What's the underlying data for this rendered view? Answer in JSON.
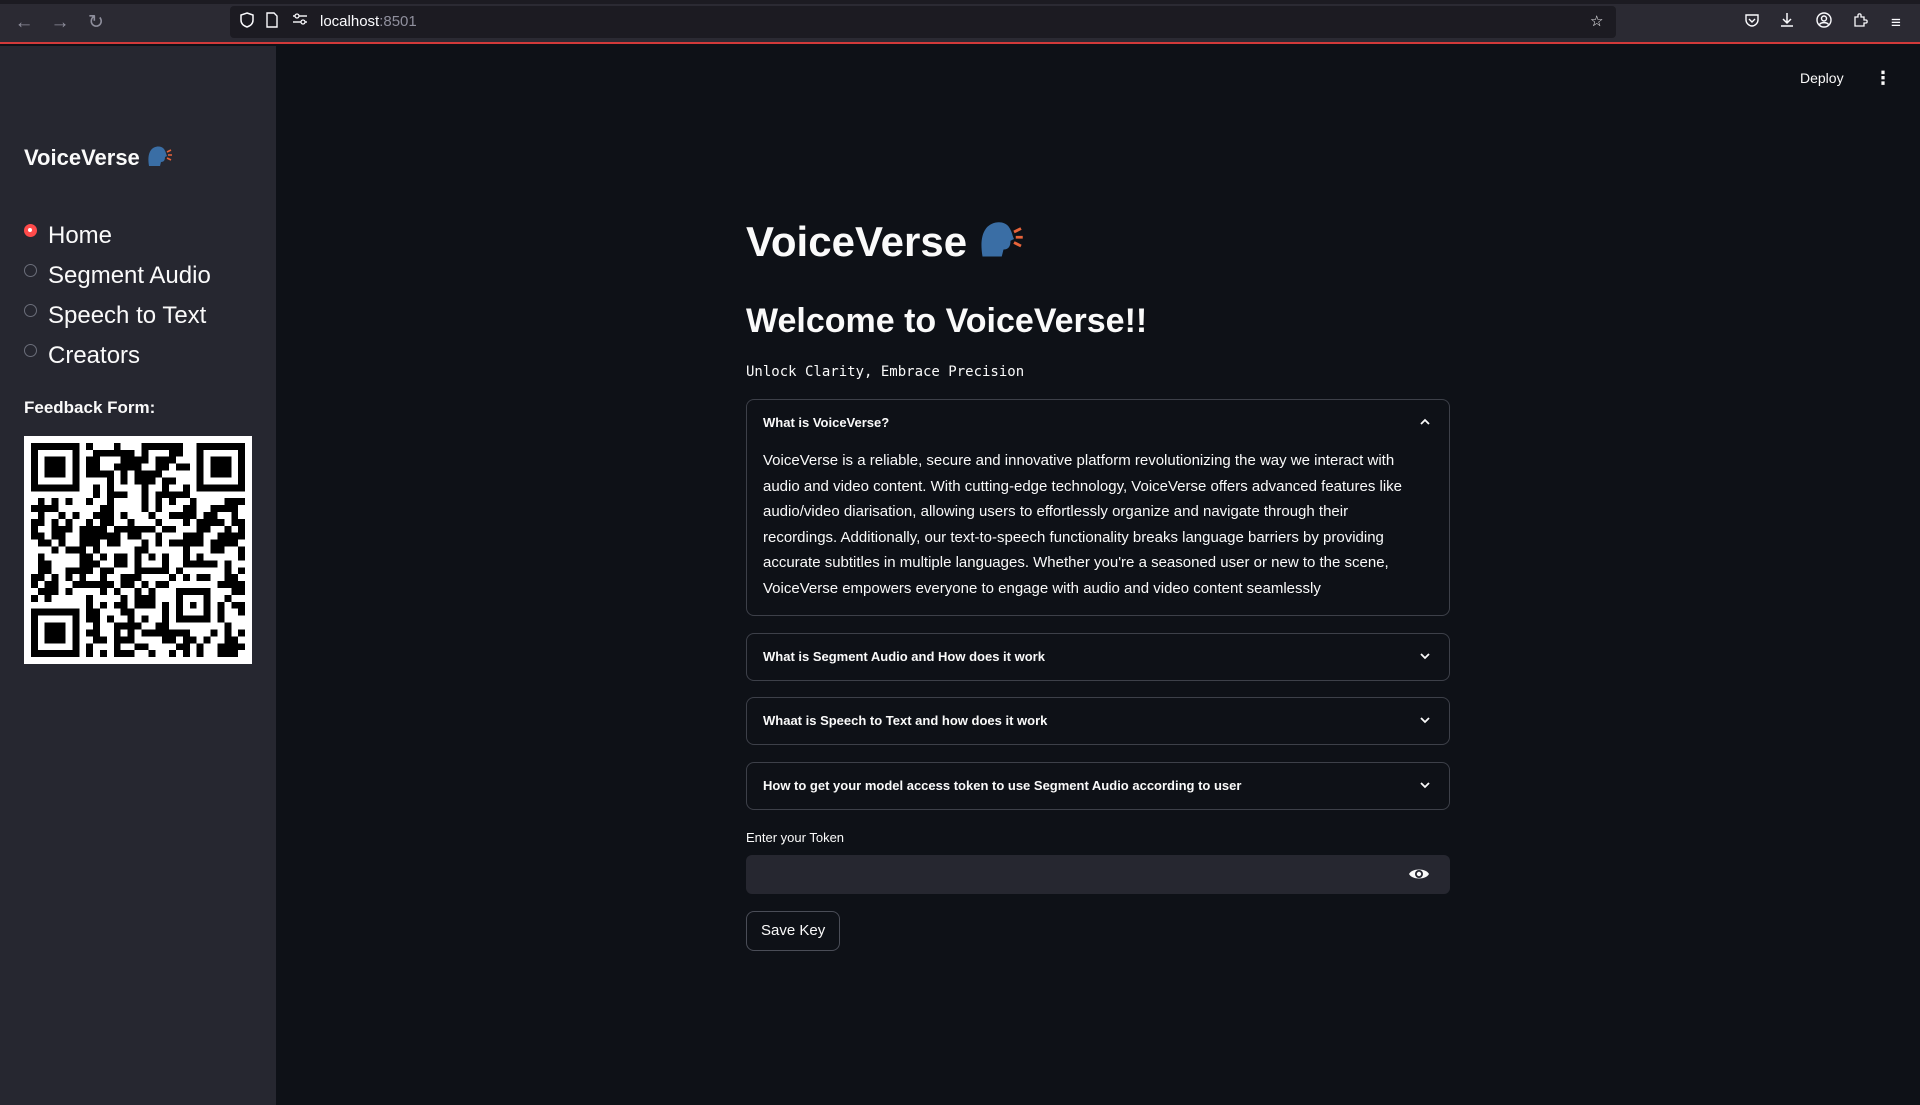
{
  "browser": {
    "url_host": "localhost",
    "url_port": ":8501",
    "icons": [
      "back-icon",
      "forward-icon",
      "reload-icon",
      "shield-icon",
      "page-icon",
      "permissions-icon",
      "bookmark-star-icon",
      "pocket-icon",
      "download-icon",
      "account-icon",
      "extensions-icon",
      "menu-icon"
    ]
  },
  "header": {
    "deploy_label": "Deploy",
    "menu_icon": "kebab-menu-icon"
  },
  "sidebar": {
    "title": "VoiceVerse",
    "title_emoji": "speaking-head-icon",
    "nav": [
      {
        "label": "Home",
        "selected": true
      },
      {
        "label": "Segment Audio",
        "selected": false
      },
      {
        "label": "Speech to Text",
        "selected": false
      },
      {
        "label": "Creators",
        "selected": false
      }
    ],
    "feedback_label": "Feedback Form:",
    "qr_icon": "qr-code-icon"
  },
  "main": {
    "title": "VoiceVerse",
    "title_emoji": "speaking-head-icon",
    "welcome": "Welcome to VoiceVerse!!",
    "tagline": "Unlock Clarity, Embrace Precision",
    "expanders": [
      {
        "title": "What is VoiceVerse?",
        "expanded": true,
        "body": "VoiceVerse is a reliable, secure and innovative platform revolutionizing the way we interact with audio and video content. With cutting-edge technology, VoiceVerse offers advanced features like audio/video diarisation, allowing users to effortlessly organize and navigate through their recordings. Additionally, our text-to-speech functionality breaks language barriers by providing accurate subtitles in multiple languages. Whether you're a seasoned user or new to the scene, VoiceVerse empowers everyone to engage with audio and video content seamlessly"
      },
      {
        "title": "What is Segment Audio and How does it work",
        "expanded": false
      },
      {
        "title": "Whaat is Speech to Text and how does it work",
        "expanded": false
      },
      {
        "title": "How to get your model access token to use Segment Audio according to user",
        "expanded": false
      }
    ],
    "token_label": "Enter your Token",
    "token_value": "",
    "save_label": "Save Key"
  },
  "colors": {
    "background": "#0e1117",
    "sidebar": "#262730",
    "accent": "#ff4b4b",
    "text": "#fafafa"
  }
}
